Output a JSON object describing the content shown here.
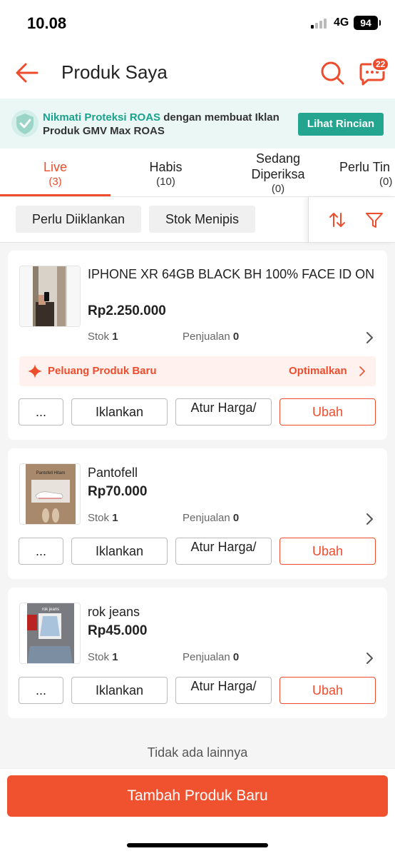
{
  "status": {
    "time": "10.08",
    "network": "4G",
    "battery": "94"
  },
  "header": {
    "title": "Produk Saya",
    "chat_badge": "22"
  },
  "banner": {
    "highlight": "Nikmati Proteksi ROAS",
    "text": " dengan membuat Iklan Produk GMV Max ROAS",
    "button": "Lihat Rincian"
  },
  "tabs": [
    {
      "label": "Live",
      "count": "(3)"
    },
    {
      "label": "Habis",
      "count": "(10)"
    },
    {
      "label": "Sedang Diperiksa",
      "count": "(0)"
    },
    {
      "label": "Perlu Tin",
      "count": "(0)"
    }
  ],
  "filters": {
    "chip1": "Perlu Diiklankan",
    "chip2": "Stok Menipis"
  },
  "products": [
    {
      "name": "IPHONE XR 64GB BLACK BH 100% FACE ID ON",
      "price": "Rp2.250.000",
      "stock_label": "Stok",
      "stock": "1",
      "sales_label": "Penjualan",
      "sales": "0"
    },
    {
      "name": "Pantofell",
      "price": "Rp70.000",
      "stock_label": "Stok",
      "stock": "1",
      "sales_label": "Penjualan",
      "sales": "0"
    },
    {
      "name": "rok jeans",
      "price": "Rp45.000",
      "stock_label": "Stok",
      "stock": "1",
      "sales_label": "Penjualan",
      "sales": "0"
    }
  ],
  "opportunity": {
    "label": "Peluang Produk Baru",
    "action": "Optimalkan"
  },
  "actions": {
    "more": "...",
    "ads": "Iklankan",
    "price": "Atur Harga/",
    "edit": "Ubah"
  },
  "thumb_texts": {
    "pantofell_title": "Pantofell Hitam",
    "rok_title": "rok jeans"
  },
  "footer": {
    "end_text": "Tidak ada lainnya",
    "add_button": "Tambah Produk Baru"
  },
  "colors": {
    "accent": "#ee4d2d",
    "roas_green": "#24a58f"
  }
}
